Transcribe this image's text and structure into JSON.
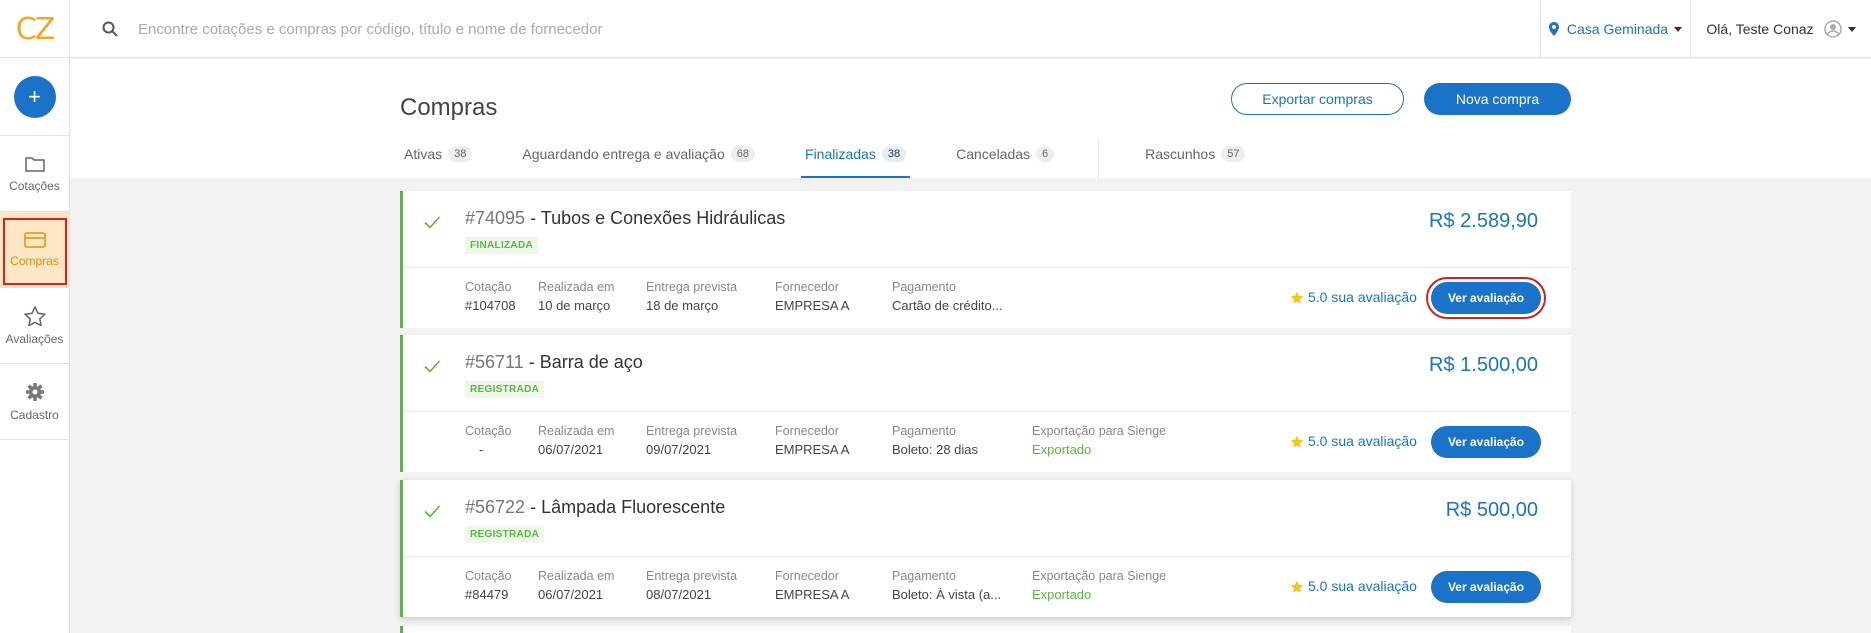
{
  "header": {
    "logo": "CZ",
    "search_placeholder": "Encontre cotações e compras por código, título e nome de fornecedor",
    "location": "Casa Geminada",
    "greeting": "Olá, Teste Conaz"
  },
  "sidebar": {
    "add_label": "+",
    "items": [
      {
        "label": "Cotações",
        "icon": "folder-icon"
      },
      {
        "label": "Compras",
        "icon": "card-icon"
      },
      {
        "label": "Avaliações",
        "icon": "star-icon"
      },
      {
        "label": "Cadastro",
        "icon": "gear-icon"
      }
    ]
  },
  "page": {
    "title": "Compras",
    "export_button": "Exportar compras",
    "new_button": "Nova compra"
  },
  "tabs": [
    {
      "label": "Ativas",
      "count": "38"
    },
    {
      "label": "Aguardando entrega e avaliação",
      "count": "68"
    },
    {
      "label": "Finalizadas",
      "count": "38"
    },
    {
      "label": "Canceladas",
      "count": "6"
    },
    {
      "label": "Rascunhos",
      "count": "57"
    }
  ],
  "labels": {
    "cotacao": "Cotação",
    "realizada": "Realizada em",
    "entrega": "Entrega prevista",
    "fornecedor": "Fornecedor",
    "pagamento": "Pagamento",
    "exportacao": "Exportação para Sienge",
    "avaliacao_suffix": "sua avaliação",
    "ver_avaliacao": "Ver avaliação"
  },
  "purchases": [
    {
      "code": "#74095",
      "title": "- Tubos e Conexões Hidráulicas",
      "status": "FINALIZADA",
      "price": "R$ 2.589,90",
      "cotacao": "#104708",
      "realizada": "10 de março",
      "entrega": "18 de março",
      "fornecedor": "EMPRESA A",
      "pagamento": "Cartão de crédito...",
      "exportacao": "",
      "rating": "5.0"
    },
    {
      "code": "#56711",
      "title": "- Barra de aço",
      "status": "REGISTRADA",
      "price": "R$ 1.500,00",
      "cotacao": "-",
      "realizada": "06/07/2021",
      "entrega": "09/07/2021",
      "fornecedor": "EMPRESA A",
      "pagamento": "Boleto: 28 dias",
      "exportacao": "Exportado",
      "rating": "5.0"
    },
    {
      "code": "#56722",
      "title": "- Lâmpada Fluorescente",
      "status": "REGISTRADA",
      "price": "R$ 500,00",
      "cotacao": "#84479",
      "realizada": "06/07/2021",
      "entrega": "08/07/2021",
      "fornecedor": "EMPRESA A",
      "pagamento": "Boleto: À vista (a...",
      "exportacao": "Exportado",
      "rating": "5.0"
    }
  ],
  "colors": {
    "primary": "#1a73c9",
    "success": "#59b93e",
    "accent": "#f5a623",
    "highlight": "#d81f1f"
  }
}
